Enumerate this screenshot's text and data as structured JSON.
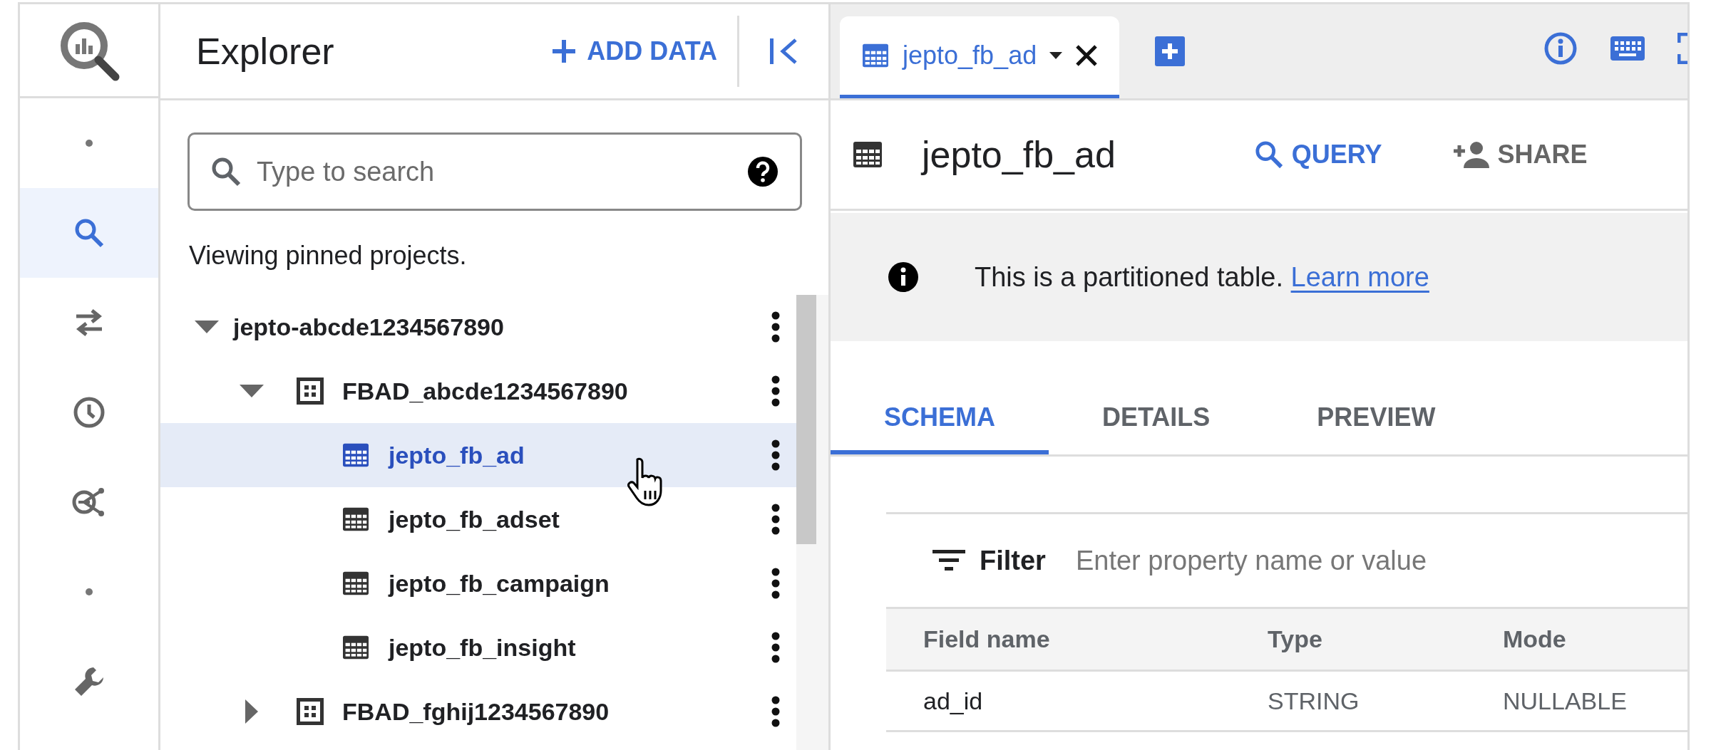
{
  "rail": {
    "items": [
      {
        "kind": "dot",
        "selected": false
      },
      {
        "kind": "search",
        "selected": true
      },
      {
        "kind": "transfer",
        "selected": false
      },
      {
        "kind": "history",
        "selected": false
      },
      {
        "kind": "graph",
        "selected": false
      },
      {
        "kind": "dot",
        "selected": false
      },
      {
        "kind": "tools",
        "selected": false
      }
    ]
  },
  "explorer": {
    "title": "Explorer",
    "add_button": "ADD DATA",
    "search": {
      "placeholder": "Type to search"
    },
    "note": "Viewing pinned projects.",
    "tree": [
      {
        "kind": "project",
        "label": "jepto-abcde1234567890",
        "expanded": true,
        "selected": false,
        "children": [
          {
            "kind": "dataset",
            "label": "FBAD_abcde1234567890",
            "expanded": true,
            "selected": false,
            "children": [
              {
                "kind": "table",
                "label": "jepto_fb_ad",
                "selected": true
              },
              {
                "kind": "table",
                "label": "jepto_fb_adset",
                "selected": false
              },
              {
                "kind": "table",
                "label": "jepto_fb_campaign",
                "selected": false
              },
              {
                "kind": "table",
                "label": "jepto_fb_insight",
                "selected": false
              }
            ]
          },
          {
            "kind": "dataset",
            "label": "FBAD_fghij1234567890",
            "expanded": false,
            "selected": false
          }
        ]
      }
    ]
  },
  "editor_tabs": [
    {
      "label": "jepto_fb_ad",
      "selected": true
    }
  ],
  "detail": {
    "title": "jepto_fb_ad",
    "actions": [
      {
        "kind": "query",
        "label": "QUERY"
      },
      {
        "kind": "share",
        "label": "SHARE"
      }
    ],
    "banner": {
      "text": "This is a partitioned table.",
      "link": "Learn more"
    },
    "tabs": [
      {
        "label": "SCHEMA",
        "selected": true
      },
      {
        "label": "DETAILS",
        "selected": false
      },
      {
        "label": "PREVIEW",
        "selected": false
      }
    ],
    "filter": {
      "label": "Filter",
      "placeholder": "Enter property name or value"
    },
    "table": {
      "columns": [
        "Field name",
        "Type",
        "Mode"
      ],
      "rows": [
        [
          "ad_id",
          "STRING",
          "NULLABLE"
        ]
      ]
    }
  }
}
